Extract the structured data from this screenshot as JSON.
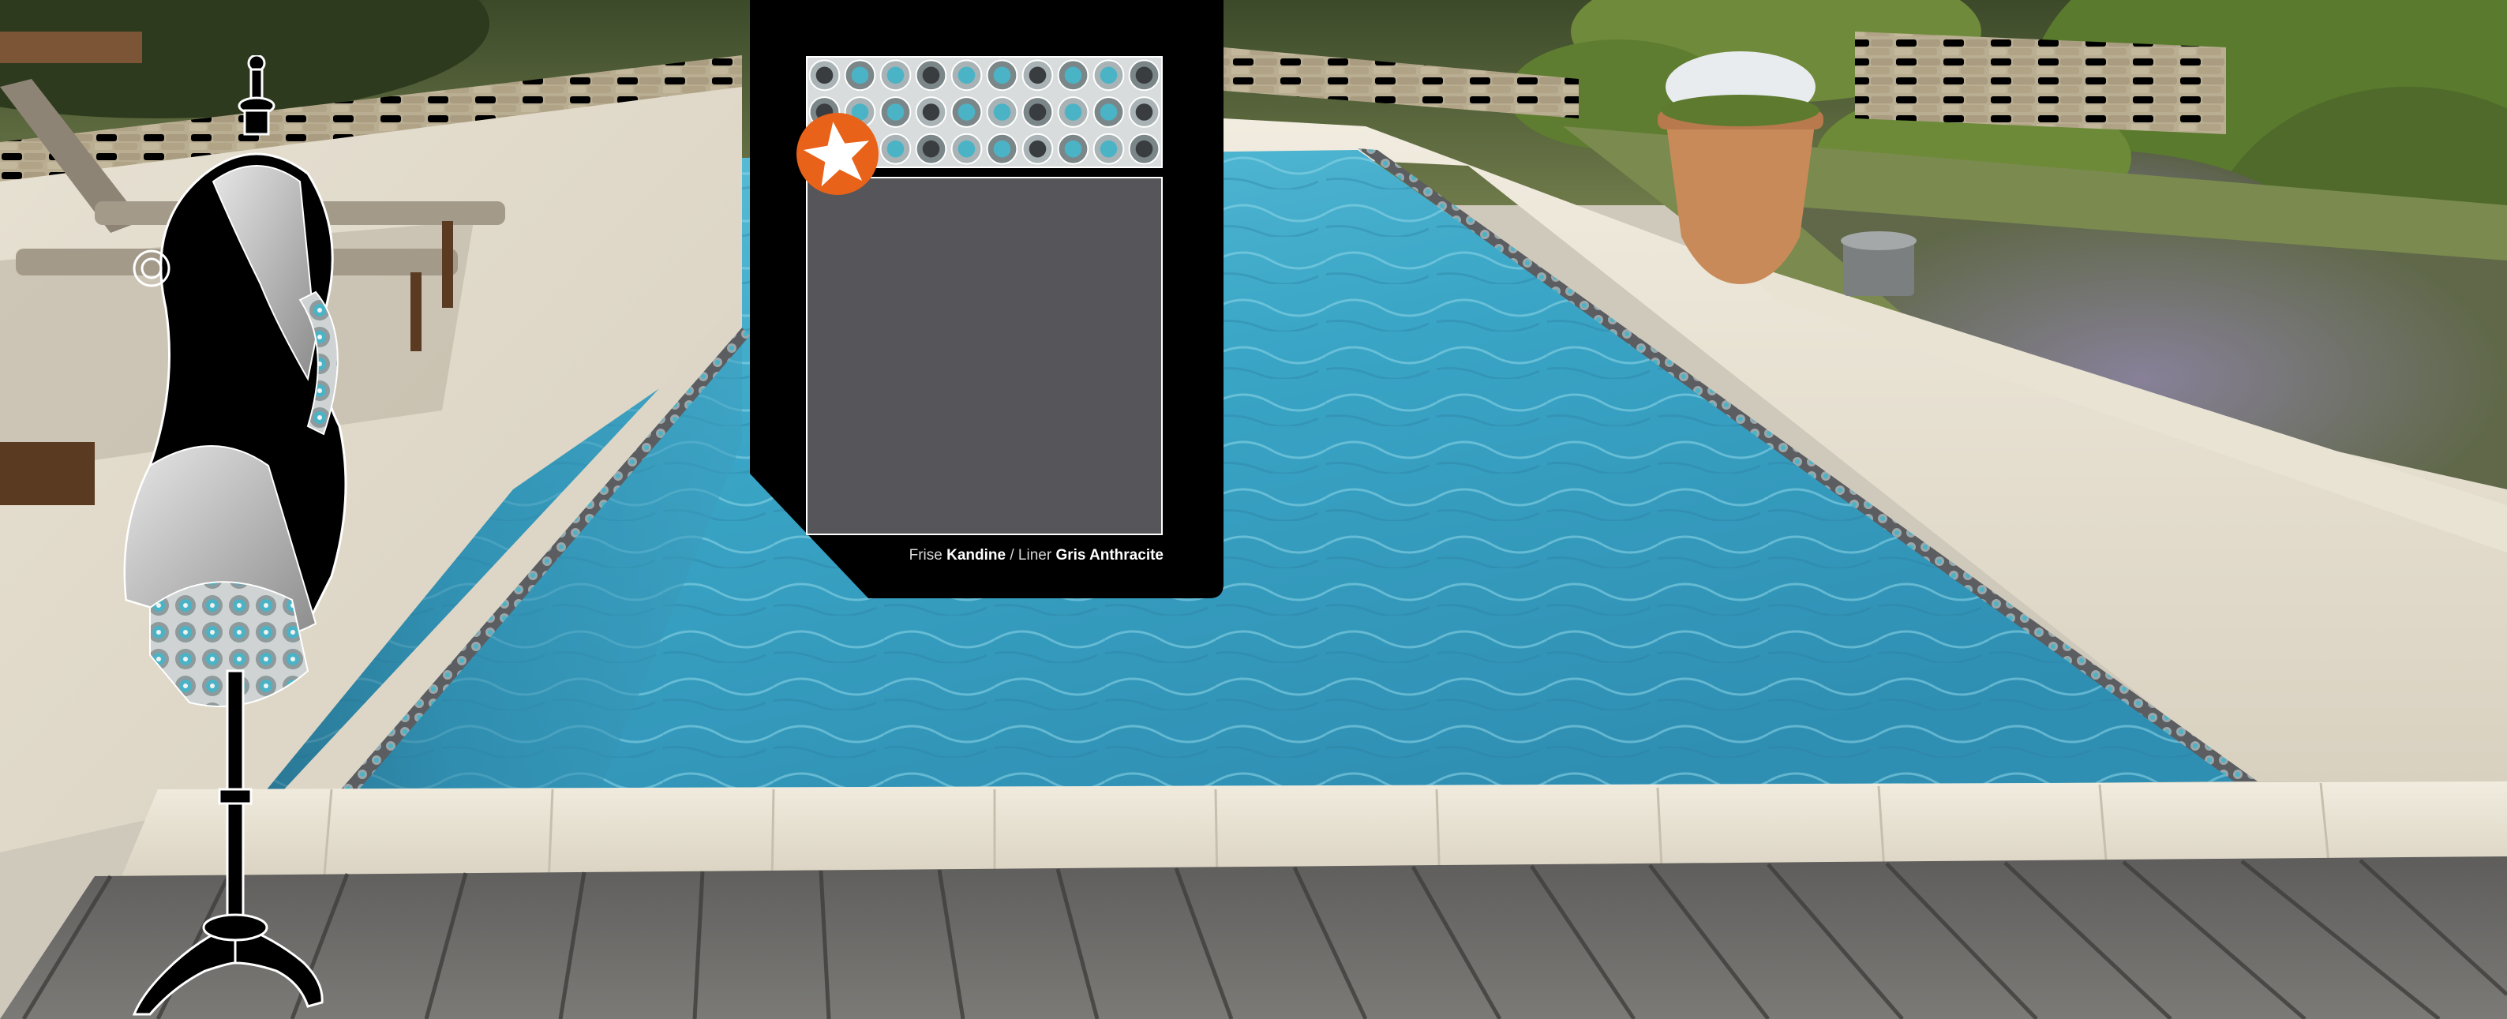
{
  "caption": {
    "frise_label": "Frise",
    "frise_name": "Kandine",
    "separator": "/",
    "liner_label": "Liner",
    "liner_name": "Gris Anthracite"
  },
  "colors": {
    "panel_bg": "#000000",
    "liner_swatch": "#56565a",
    "badge": "#e8621a",
    "pool_water": "#3fa6c4",
    "deck_wood": "#6e6d6b",
    "mosaic_teal": "#4bb3c6"
  },
  "icons": {
    "badge": "star-icon",
    "mannequin": "dress-form-icon"
  }
}
